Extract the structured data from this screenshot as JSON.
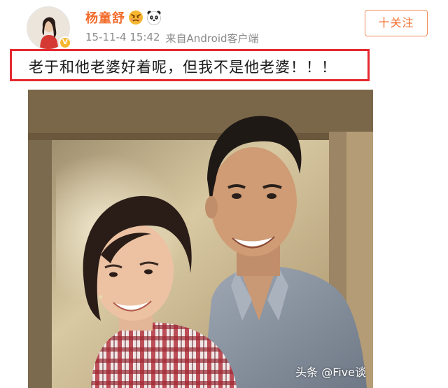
{
  "user": {
    "name": "杨童舒",
    "badge": "V",
    "emoji_icons": [
      "angry-face-emoji",
      "panda-emoji"
    ]
  },
  "post": {
    "date": "15-11-4 15:42",
    "source": "来自Android客户端",
    "text": "老于和他老婆好着呢，但我不是他老婆！！！",
    "highlight_color": "#e5282f"
  },
  "follow_button": {
    "label": "十关注"
  },
  "watermark": "头条 @Five谈",
  "colors": {
    "username": "#f26b2b",
    "meta": "#8a8a8a",
    "follow_border": "#f08b5b"
  }
}
